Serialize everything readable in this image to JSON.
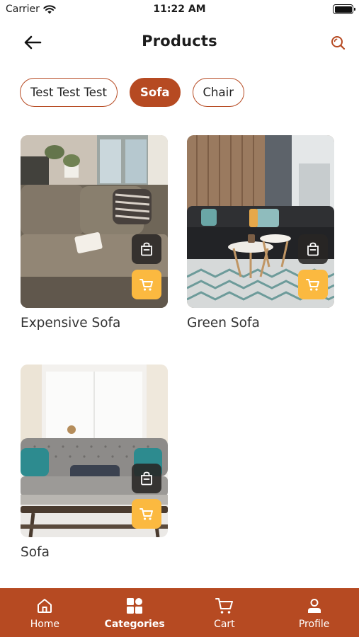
{
  "status_bar": {
    "carrier": "Carrier",
    "time": "11:22 AM"
  },
  "header": {
    "title": "Products",
    "back_icon": "arrow-left-icon",
    "search_icon": "search-icon"
  },
  "filters": [
    {
      "label": "Test Test Test",
      "selected": false
    },
    {
      "label": "Sofa",
      "selected": true
    },
    {
      "label": "Chair",
      "selected": false
    }
  ],
  "products": [
    {
      "name": "Expensive Sofa"
    },
    {
      "name": "Green Sofa"
    },
    {
      "name": "Sofa"
    }
  ],
  "bottom_nav": [
    {
      "label": "Home",
      "icon": "home-icon",
      "active": false
    },
    {
      "label": "Categories",
      "icon": "grid-icon",
      "active": true
    },
    {
      "label": "Cart",
      "icon": "cart-icon",
      "active": false
    },
    {
      "label": "Profile",
      "icon": "user-icon",
      "active": false
    }
  ],
  "colors": {
    "primary": "#b64a22",
    "cart_button": "#fbb940",
    "background": "#ffffff"
  }
}
